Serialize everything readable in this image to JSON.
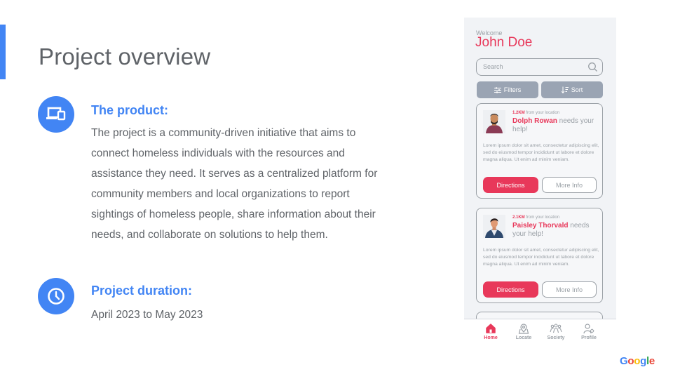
{
  "slide": {
    "title": "Project overview",
    "product": {
      "heading": "The product:",
      "body": "The project is a community-driven initiative that aims to connect homeless individuals with the resources and assistance they need. It serves as a centralized platform for community members and local organizations to report sightings of homeless people, share information about their needs, and collaborate on solutions to help them.",
      "icon": "devices-icon"
    },
    "duration": {
      "heading": "Project duration:",
      "body": "April 2023 to May 2023",
      "icon": "clock-icon"
    },
    "logo": "Google"
  },
  "app": {
    "welcome": "Welcome",
    "user_name": "John Doe",
    "search_placeholder": "Search",
    "filters_label": "Filters",
    "sort_label": "Sort",
    "cards": [
      {
        "distance": "1.2KM",
        "distance_suffix": "from your location",
        "name": "Dolph Rowan",
        "needs_text": "needs your help!",
        "description": "Lorem ipsum dolor sit amet, consectetur adipiscing elit, sed do eiusmod tempor incididunt ut labore et dolore magna aliqua. Ut enim ad minim veniam.",
        "directions_label": "Directions",
        "more_info_label": "More Info"
      },
      {
        "distance": "2.1KM",
        "distance_suffix": "from your location",
        "name": "Paisley Thorvald",
        "needs_text": "needs your help!",
        "description": "Lorem ipsum dolor sit amet, consectetur adipiscing elit, sed do eiusmod tempor incididunt ut labore et dolore magna aliqua. Ut enim ad minim veniam.",
        "directions_label": "Directions",
        "more_info_label": "More Info"
      }
    ],
    "nav": [
      {
        "label": "Home",
        "icon": "home-icon",
        "active": true
      },
      {
        "label": "Locate",
        "icon": "locate-icon",
        "active": false
      },
      {
        "label": "Society",
        "icon": "society-icon",
        "active": false
      },
      {
        "label": "Profile",
        "icon": "profile-icon",
        "active": false
      }
    ]
  },
  "colors": {
    "accent_blue": "#4285f4",
    "brand_pink": "#e8385a",
    "text_gray": "#5f6368",
    "muted_gray": "#9aa0a6"
  }
}
